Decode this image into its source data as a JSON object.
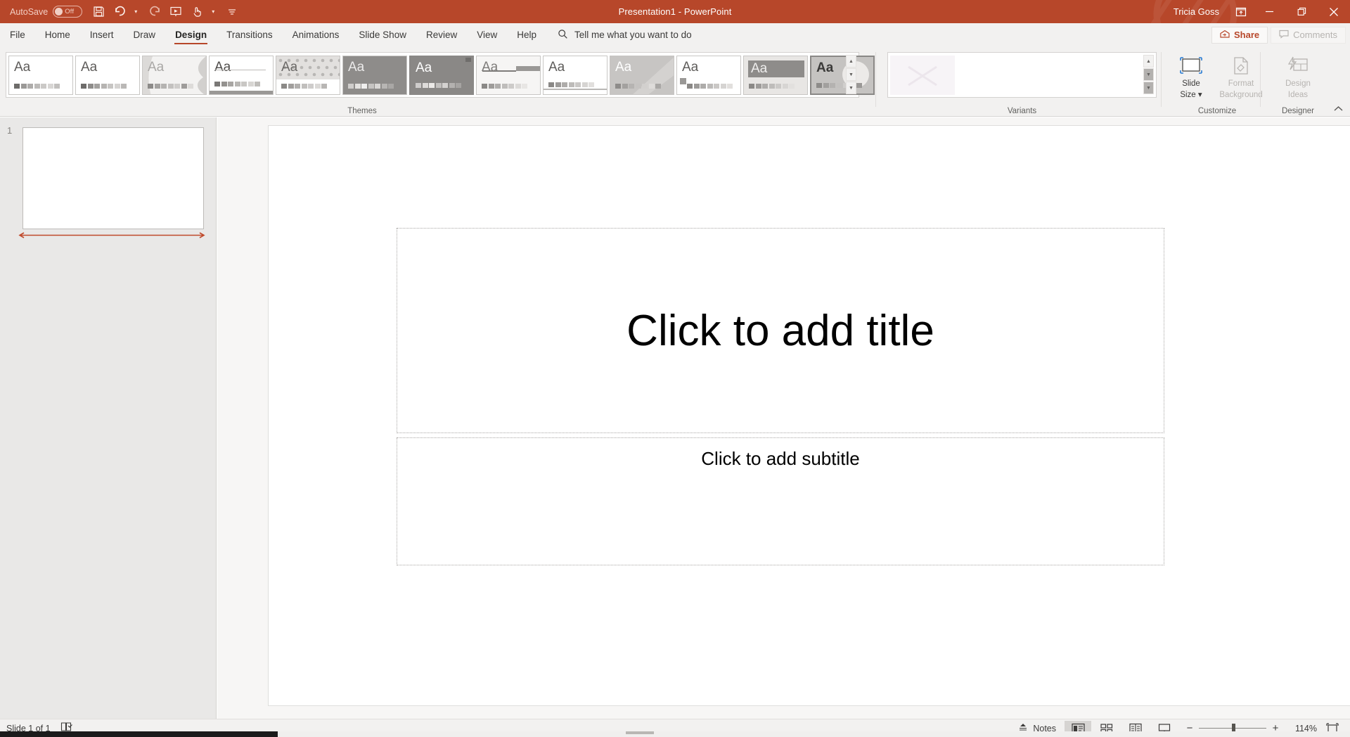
{
  "titlebar": {
    "autosave_label": "AutoSave",
    "autosave_state": "Off",
    "title": "Presentation1  -  PowerPoint",
    "user": "Tricia Goss",
    "qat": [
      {
        "name": "save-icon",
        "label": "Save"
      },
      {
        "name": "undo-icon",
        "label": "Undo"
      },
      {
        "name": "redo-icon",
        "label": "Redo"
      },
      {
        "name": "start-slideshow-icon",
        "label": "Start From Beginning"
      },
      {
        "name": "touch-mode-icon",
        "label": "Touch/Mouse Mode"
      },
      {
        "name": "customize-qat-icon",
        "label": "Customize Quick Access Toolbar"
      }
    ],
    "window_buttons": [
      {
        "name": "ribbon-display-options-icon",
        "glyph": "⬒"
      },
      {
        "name": "minimize-button",
        "glyph": "—"
      },
      {
        "name": "restore-button",
        "glyph": "❐"
      },
      {
        "name": "close-button",
        "glyph": "✕"
      }
    ],
    "accent_color": "#b7472a"
  },
  "tabs": [
    {
      "label": "File",
      "active": false
    },
    {
      "label": "Home",
      "active": false
    },
    {
      "label": "Insert",
      "active": false
    },
    {
      "label": "Draw",
      "active": false
    },
    {
      "label": "Design",
      "active": true
    },
    {
      "label": "Transitions",
      "active": false
    },
    {
      "label": "Animations",
      "active": false
    },
    {
      "label": "Slide Show",
      "active": false
    },
    {
      "label": "Review",
      "active": false
    },
    {
      "label": "View",
      "active": false
    },
    {
      "label": "Help",
      "active": false
    }
  ],
  "tellme": {
    "placeholder": "Tell me what you want to do",
    "icon": "search-icon"
  },
  "share": {
    "label": "Share",
    "icon": "share-icon"
  },
  "comments": {
    "label": "Comments",
    "icon": "comment-icon",
    "disabled": true
  },
  "ribbon": {
    "groups": [
      {
        "label": "Themes"
      },
      {
        "label": "Variants"
      },
      {
        "label": "Customize"
      },
      {
        "label": "Designer"
      }
    ],
    "themes": [
      {
        "name": "office-theme",
        "aa": "Aa",
        "bg": "#ffffff",
        "aa_color": "#5e5c5a",
        "swatches": [
          "#6e6c6a",
          "#9b9997",
          "#aeacaa",
          "#bcbab8",
          "#cbc9c7",
          "#d8d6d4",
          "#c2c0be"
        ],
        "selected": false
      },
      {
        "name": "facet-theme",
        "aa": "Aa",
        "bg": "#ffffff",
        "aa_color": "#5e5c5a",
        "swatches": [
          "#6e6c6a",
          "#8e8c8a",
          "#a3a19f",
          "#b6b4b2",
          "#c7c5c3",
          "#d5d3d1",
          "#bab8b6"
        ],
        "selected": false
      },
      {
        "name": "wisp-theme",
        "aa": "Aa",
        "bg": "#f3f2f1",
        "aa_color": "#aaa8a6",
        "swatches": [
          "#8d8b89",
          "#a5a3a1",
          "#b5b3b1",
          "#c3c1bf",
          "#cfcdcb",
          "#9e9c9a",
          "#dddbd9"
        ],
        "selected": false
      },
      {
        "name": "banded-theme",
        "aa": "Aa",
        "bg": "#ffffff",
        "aa_color": "#4e4c4a",
        "swatches": [
          "#7a7876",
          "#94928f",
          "#a8a6a3",
          "#b9b7b4",
          "#c9c7c4",
          "#d7d5d2",
          "#bfbdba"
        ],
        "selected": false
      },
      {
        "name": "basis-theme",
        "aa": "Aa",
        "bg": "#e7e5e3",
        "aa_color": "#6b6967",
        "swatches": [
          "#8b8987",
          "#a09e9c",
          "#b2b0ae",
          "#c1bfbd",
          "#cecccb",
          "#dbd9d7",
          "#b8b6b4"
        ],
        "selected": false
      },
      {
        "name": "berlin-theme",
        "aa": "Aa",
        "bg": "#8e8c8a",
        "aa_color": "#ebeaea",
        "swatches": [
          "#cfcdcb",
          "#e4e2e0",
          "#efeeed",
          "#c6c4c2",
          "#d9d7d5",
          "#b7b5b3",
          "#a9a7a5"
        ],
        "selected": false
      },
      {
        "name": "celestial-theme",
        "aa": "Aa",
        "bg": "#8a8886",
        "aa_color": "#ffffff",
        "swatches": [
          "#cecccb",
          "#dedcda",
          "#ebe9e7",
          "#c2c0be",
          "#d4d2d0",
          "#b3b1af",
          "#a6a4a2"
        ],
        "selected": false
      },
      {
        "name": "circuit-theme",
        "aa": "Aa",
        "bg": "#f6f5f4",
        "aa_color": "#7e7c7a",
        "swatches": [
          "#8b8987",
          "#9e9c9a",
          "#b0aeac",
          "#bfbdbb",
          "#cdcbc9",
          "#dcdad8",
          "#e8e6e4"
        ],
        "selected": false
      },
      {
        "name": "damask-theme",
        "aa": "Aa",
        "bg": "#ffffff",
        "aa_color": "#5e5c5a",
        "swatches": [
          "#7c7a78",
          "#939190",
          "#a7a5a3",
          "#b8b6b4",
          "#c8c6c4",
          "#d6d4d2",
          "#e3e1df"
        ],
        "selected": false
      },
      {
        "name": "depth-theme",
        "aa": "Aa",
        "bg": "#c7c5c3",
        "aa_color": "#ffffff",
        "swatches": [
          "#8e8c8a",
          "#a3a19f",
          "#b6b4b2",
          "#c5c3c1",
          "#d2d0ce",
          "#dedcda",
          "#a9a7a5"
        ],
        "selected": false
      },
      {
        "name": "dividend-theme",
        "aa": "Aa",
        "bg": "#ffffff",
        "aa_color": "#5e5c5a",
        "swatches": [
          "#8a8886",
          "#9d9b99",
          "#aeacaa",
          "#bdbbb9",
          "#cac8c6",
          "#d6d4d2",
          "#e1dfdd"
        ],
        "selected": false
      },
      {
        "name": "droplet-theme",
        "aa": "Aa",
        "bg": "#e8e6e4",
        "aa_color": "#6b6967",
        "swatches": [
          "#8b8987",
          "#9e9c9a",
          "#afadab",
          "#bebcba",
          "#cbc9c7",
          "#d7d5d3",
          "#e2e0de"
        ],
        "selected": false
      },
      {
        "name": "frame-theme",
        "aa": "Aa",
        "bg": "#c5c3c1",
        "aa_color": "#3b3a39",
        "swatches": [
          "#8d8b89",
          "#a2a09e",
          "#b4b2b0",
          "#c3c1bf",
          "#d0cecc",
          "#dbd9d7",
          "#9a9896"
        ],
        "selected": true
      }
    ],
    "theme_scroll": [
      {
        "name": "themes-scroll-up-icon",
        "glyph": "▲"
      },
      {
        "name": "themes-scroll-down-icon",
        "glyph": "▼"
      },
      {
        "name": "themes-more-icon",
        "glyph": "≡"
      }
    ],
    "variants": [
      {
        "name": "variant-blank",
        "bg": "#f7f4f7"
      }
    ],
    "variant_scroll": [
      {
        "name": "variants-scroll-up-icon",
        "glyph": "▲"
      },
      {
        "name": "variants-scroll-down-icon",
        "glyph": "▼"
      },
      {
        "name": "variants-more-icon",
        "glyph": "≡"
      }
    ],
    "customize": [
      {
        "name": "slide-size-button",
        "line1": "Slide",
        "line2": "Size ▾",
        "icon": "slide-size-icon",
        "disabled": false
      },
      {
        "name": "format-background-button",
        "line1": "Format",
        "line2": "Background",
        "icon": "format-background-icon",
        "disabled": true
      }
    ],
    "designer": [
      {
        "name": "design-ideas-button",
        "line1": "Design",
        "line2": "Ideas",
        "icon": "design-ideas-icon",
        "disabled": true
      }
    ],
    "collapse": {
      "name": "collapse-ribbon-icon",
      "glyph": "⌃"
    }
  },
  "thumbnails": [
    {
      "number": "1"
    }
  ],
  "slide": {
    "title_placeholder": "Click to add title",
    "subtitle_placeholder": "Click to add subtitle"
  },
  "statusbar": {
    "slide_count": "Slide 1 of 1",
    "accessibility_icon": "accessibility-checker-icon",
    "notes_label": "Notes",
    "notes_icon": "notes-icon",
    "views": [
      {
        "name": "normal-view-button",
        "label": "Normal",
        "active": true
      },
      {
        "name": "slide-sorter-button",
        "label": "Slide Sorter",
        "active": false
      },
      {
        "name": "reading-view-button",
        "label": "Reading View",
        "active": false
      },
      {
        "name": "slide-show-button",
        "label": "Slide Show",
        "active": false
      }
    ],
    "zoom_out": "−",
    "zoom_in": "+",
    "zoom_level": "114%",
    "fit_slide_icon": "fit-to-window-icon"
  }
}
